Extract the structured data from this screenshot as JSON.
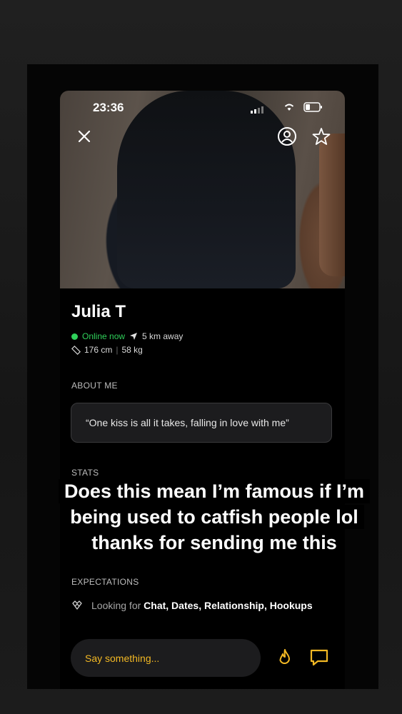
{
  "status_bar": {
    "time": "23:36"
  },
  "profile": {
    "name": "Julia T",
    "online_status": "Online now",
    "distance": "5 km away",
    "height": "176 cm",
    "weight": "58 kg"
  },
  "about": {
    "label": "ABOUT ME",
    "quote": "“One kiss is all it takes, falling in love with me”"
  },
  "stats": {
    "label": "STATS"
  },
  "expectations": {
    "label": "EXPECTATIONS",
    "looking_prefix": "Looking for",
    "looking_values": "Chat, Dates, Relationship, Hookups"
  },
  "message": {
    "placeholder": "Say something..."
  },
  "caption": {
    "line1": "Does this mean I’m famous if I’m",
    "line2": "being used to catfish people lol",
    "line3": "thanks for sending me this"
  },
  "colors": {
    "online": "#2fd05a",
    "accent": "#f2b824",
    "background": "#000000"
  },
  "icons": [
    "close-icon",
    "profile-icon",
    "star-icon",
    "location-arrow-icon",
    "ruler-icon",
    "handshake-icon",
    "flame-icon",
    "chat-icon"
  ]
}
